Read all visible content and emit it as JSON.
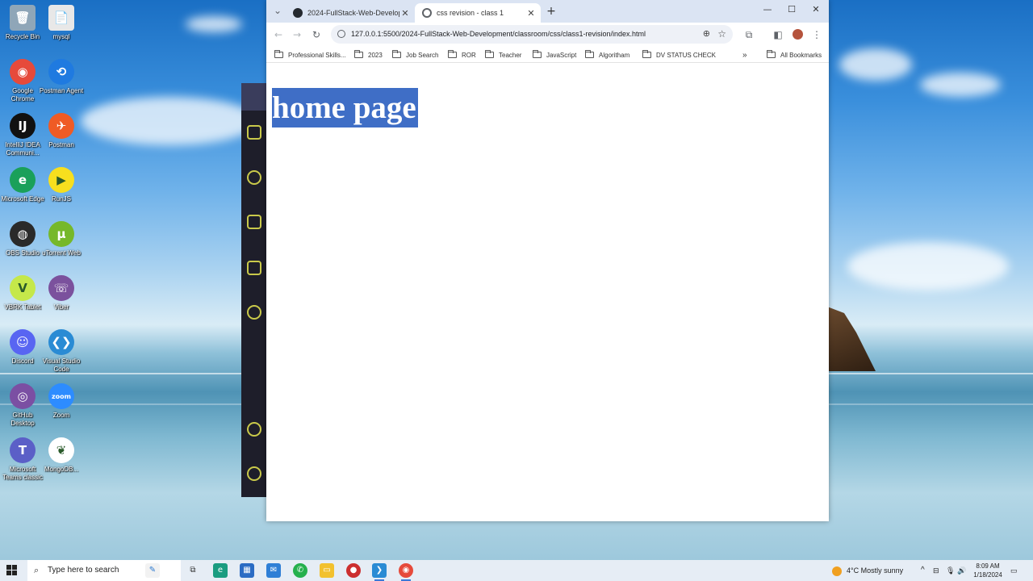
{
  "desktop": {
    "icons": [
      {
        "label": "Recycle Bin",
        "glyph": "🗑",
        "color": "#8fa6b8"
      },
      {
        "label": "mysql",
        "glyph": "📄",
        "color": "#e8e8e8"
      },
      {
        "label": "Google Chrome",
        "glyph": "◉",
        "color": "#e64a3b"
      },
      {
        "label": "Postman Agent",
        "glyph": "⟲",
        "color": "#1f7ae0"
      },
      {
        "label": "IntelliJ IDEA Communi...",
        "glyph": "IJ",
        "color": "#111111"
      },
      {
        "label": "Postman",
        "glyph": "✈",
        "color": "#ef5b25"
      },
      {
        "label": "Microsoft Edge",
        "glyph": "e",
        "color": "#1aa05a"
      },
      {
        "label": "RunJS",
        "glyph": "▶",
        "color": "#f7df1e"
      },
      {
        "label": "OBS Studio",
        "glyph": "◍",
        "color": "#2a2a2a"
      },
      {
        "label": "uTorrent Web",
        "glyph": "µ",
        "color": "#76b82a"
      },
      {
        "label": "VBRK Tablet",
        "glyph": "V",
        "color": "#c5e84a"
      },
      {
        "label": "Viber",
        "glyph": "☏",
        "color": "#7b519d"
      },
      {
        "label": "Discord",
        "glyph": "☺",
        "color": "#5865f2"
      },
      {
        "label": "Visual Studio Code",
        "glyph": "❮❯",
        "color": "#2a8bd4"
      },
      {
        "label": "GitHub Desktop",
        "glyph": "◎",
        "color": "#7b4fa3"
      },
      {
        "label": "Zoom",
        "glyph": "zoom",
        "color": "#2d8cff"
      },
      {
        "label": "Microsoft Teams classic",
        "glyph": "T",
        "color": "#5b5fc7"
      },
      {
        "label": "MongoDB...",
        "glyph": "❦",
        "color": "#ffffff"
      }
    ]
  },
  "browser": {
    "tabs": [
      {
        "title": "2024-FullStack-Web-Developm",
        "active": false,
        "favicon_color": "#24292f"
      },
      {
        "title": "css revision - class 1",
        "active": true,
        "favicon_color": "#5f6368"
      }
    ],
    "new_tab": "+",
    "tab_list": "⌄",
    "window_controls": {
      "minimize": "—",
      "maximize": "☐",
      "close": "✕"
    },
    "url": "127.0.0.1:5500/2024-FullStack-Web-Development/classroom/css/class1-revision/index.html",
    "bookmarks": [
      "Professional Skills...",
      "2023",
      "Job Search",
      "ROR",
      "Teacher",
      "JavaScript",
      "Algoritham",
      "DV STATUS CHECK"
    ],
    "bookmarks_overflow": "»",
    "all_bookmarks": "All Bookmarks",
    "page": {
      "heading": "home page",
      "heading_bg": "#3f6ec6"
    }
  },
  "taskbar": {
    "search_placeholder": "Type here to search",
    "weather": "4°C  Mostly sunny",
    "time": "8:09 AM",
    "date": "1/18/2024"
  }
}
